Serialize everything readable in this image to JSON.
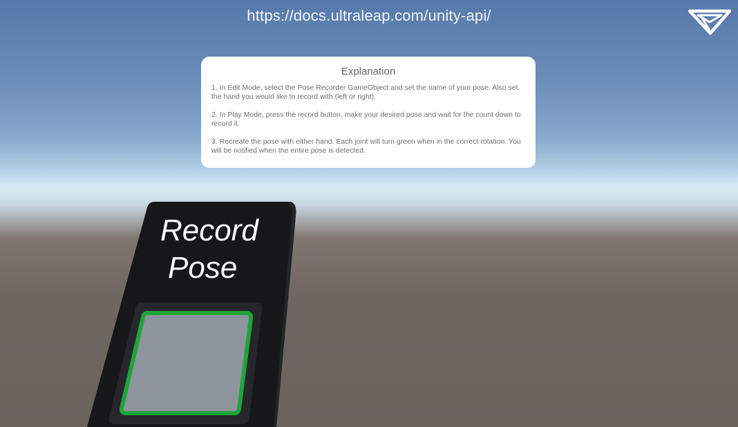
{
  "overlay": {
    "url": "https://docs.ultraleap.com/unity-api/",
    "logo_icon": "ultraleap-logo-icon"
  },
  "explanation_panel": {
    "title": "Explanation",
    "paragraphs": [
      "1. In Edit Mode, select the Pose Recorder GameObject and set the name of your pose. Also set the hand you would like to record with (left or right).",
      "2. In Play Mode, press the record button, make your desired pose and wait for the count down to record it.",
      "3. Recreate the pose with either hand. Each joint will turn green when in the correct rotation. You will be notified when the entire pose is detected."
    ]
  },
  "record_device": {
    "label_line1": "Record",
    "label_line2": "Pose",
    "button_outline_color": "#1fa43a",
    "button_fill_color": "#8f959e",
    "device_color": "#161719"
  }
}
